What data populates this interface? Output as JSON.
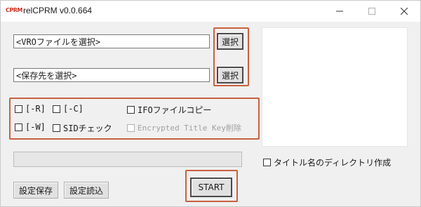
{
  "window": {
    "title": "relCPRM v0.0.664",
    "icon_name": "app-logo-icon",
    "icon_text": "CPRM",
    "accent": "#c9603f"
  },
  "inputs": {
    "vro_path": "<VROファイルを選択>",
    "dest_path": "<保存先を選択>"
  },
  "buttons": {
    "select_vro": "選択",
    "select_dest": "選択",
    "save_settings": "設定保存",
    "load_settings": "設定読込",
    "start": "START"
  },
  "options": {
    "r": "[-R]",
    "c": "[-C]",
    "ifo_copy": "IFOファイルコピー",
    "w": "[-W]",
    "sid_check": "SIDチェック",
    "encrypted_title_key_delete": "Encrypted Title Key削除",
    "title_dir": "タイトル名のディレクトリ作成"
  },
  "progress": {
    "value": 0
  }
}
